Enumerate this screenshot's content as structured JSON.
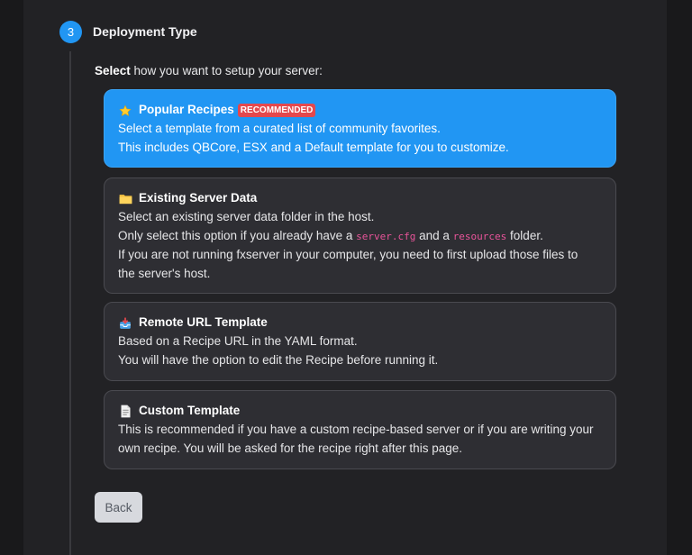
{
  "step": {
    "number": "3",
    "title": "Deployment Type"
  },
  "intro": {
    "bold": "Select",
    "rest": " how you want to setup your server:"
  },
  "cards": [
    {
      "title": "Popular Recipes",
      "badge": "RECOMMENDED",
      "icon": "star-icon",
      "line1": "Select a template from a curated list of community favorites.",
      "line2": "This includes QBCore, ESX and a Default template for you to customize."
    },
    {
      "title": "Existing Server Data",
      "icon": "folder-icon",
      "line1": "Select an existing server data folder in the host.",
      "line2_a": "Only select this option if you already have a ",
      "code1": "server.cfg",
      "line2_b": " and a ",
      "code2": "resources",
      "line2_c": " folder.",
      "line3": "If you are not running fxserver in your computer, you need to first upload those files to",
      "line4": "the server's host."
    },
    {
      "title": "Remote URL Template",
      "icon": "inbox-tray-icon",
      "line1": "Based on a Recipe URL in the YAML format.",
      "line2": "You will have the option to edit the Recipe before running it."
    },
    {
      "title": "Custom Template",
      "icon": "document-icon",
      "line1": "This is recommended if you have a custom recipe-based server or if you are writing your",
      "line2": "own recipe. You will be asked for the recipe right after this page."
    }
  ],
  "back_button": "Back",
  "colors": {
    "accent": "#2196f3",
    "badge": "#e5484d",
    "code": "#e8549a"
  }
}
